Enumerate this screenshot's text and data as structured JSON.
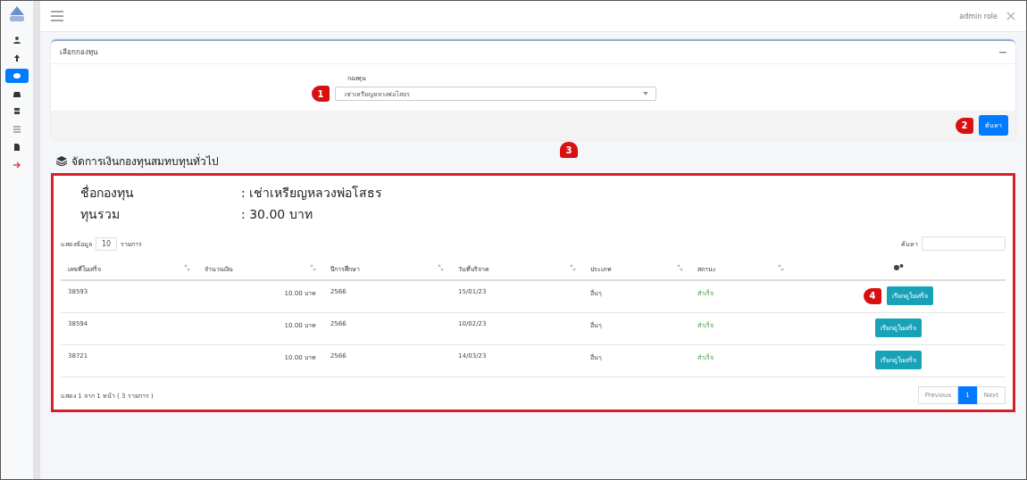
{
  "topbar": {
    "user": "admin role"
  },
  "sidebar": {
    "items": [
      {
        "selected": false
      },
      {
        "selected": false
      },
      {
        "selected": true
      },
      {
        "selected": false
      },
      {
        "selected": false
      },
      {
        "selected": false
      },
      {
        "selected": false
      },
      {
        "selected": false
      }
    ]
  },
  "filter_card": {
    "title": "เลือกกองทุน",
    "field_label": "กองทุน",
    "select_value": "เช่าเหรียญหลวงพ่อโสธร",
    "select_callout": "1",
    "button": "ค้นหา",
    "button_callout": "2"
  },
  "section": {
    "title": "จัดการเงินกองทุนสมทบทุนทั่วไป",
    "callout": "3",
    "summary": [
      {
        "label": "ชื่อกองทุน",
        "value": ": เช่าเหรียญหลวงพ่อโสธร"
      },
      {
        "label": "ทุนรวม",
        "value": ": 30.00 บาท"
      }
    ],
    "length": {
      "before": "แสดงข้อมูล",
      "value": "10",
      "after": "รายการ"
    },
    "search_label": "ค้นหา",
    "table": {
      "columns": [
        "เลขที่ใบเสร็จ",
        "จำนวนเงิน",
        "ปีการศึกษา",
        "วันที่บริจาค",
        "ประเภท",
        "สถานะ"
      ],
      "rows": [
        {
          "receipt": "38593",
          "amount": "10.00 บาท",
          "year": "2566",
          "date": "15/01/23",
          "type": "อื่นๆ",
          "status": "สำเร็จ",
          "action": "เรียกดูใบเสร็จ",
          "callout": "4"
        },
        {
          "receipt": "38594",
          "amount": "10.00 บาท",
          "year": "2566",
          "date": "10/02/23",
          "type": "อื่นๆ",
          "status": "สำเร็จ",
          "action": "เรียกดูใบเสร็จ"
        },
        {
          "receipt": "38721",
          "amount": "10.00 บาท",
          "year": "2566",
          "date": "14/03/23",
          "type": "อื่นๆ",
          "status": "สำเร็จ",
          "action": "เรียกดูใบเสร็จ"
        }
      ]
    },
    "info": "แสดง 1 จาก 1 หน้า ( 3 รายการ )",
    "pagination": [
      {
        "label": "Previous",
        "selected": false
      },
      {
        "label": "1",
        "selected": true
      },
      {
        "label": "Next",
        "selected": false
      }
    ]
  }
}
